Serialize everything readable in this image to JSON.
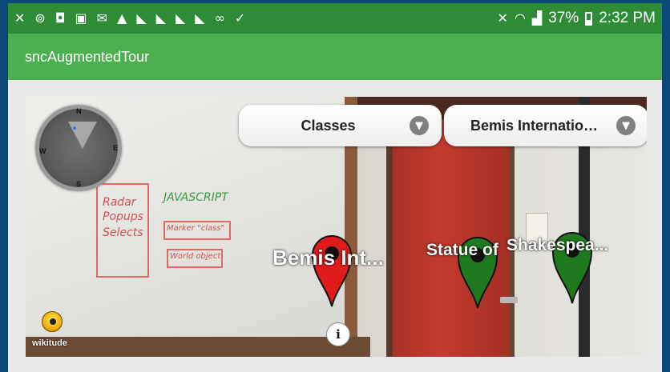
{
  "status_bar": {
    "icons": [
      "airplane-cross-icon",
      "sync-icon",
      "instagram-icon",
      "image-icon",
      "mail-icon",
      "warning-icon",
      "flipboard-icon",
      "flipboard-icon",
      "flipboard-icon",
      "flipboard-icon",
      "voicemail-icon",
      "clipboard-check-icon"
    ],
    "icon_glyphs": [
      "✕",
      "⊚",
      "◘",
      "▣",
      "✉",
      "▲",
      "◣",
      "◣",
      "◣",
      "◣",
      "∞",
      "✓"
    ],
    "battery_percent": "37%",
    "battery_level": 0.37,
    "time": "2:32 PM"
  },
  "app_bar": {
    "title": "sncAugmentedTour"
  },
  "ar_view": {
    "dropdowns": [
      {
        "label": "Classes"
      },
      {
        "label": "Bemis Internatio…"
      }
    ],
    "markers": [
      {
        "label": "Bemis Int...",
        "color": "#e01b1b"
      },
      {
        "label": "Statue of",
        "color": "#1f7a1f"
      },
      {
        "label": "Shakespea...",
        "color": "#1f7a1f"
      }
    ],
    "radar": {
      "north": "N",
      "east": "E",
      "south": "S",
      "west": "W"
    },
    "wikitude_text": "wikitude",
    "info_glyph": "i"
  },
  "whiteboard_text": {
    "radar": "Radar",
    "popups": "Popups",
    "selects": "Selects",
    "javascript": "JAVASCRIPT",
    "marker": "Marker \"class\"",
    "world": "World object"
  },
  "colors": {
    "status_bar": "#2e8b36",
    "app_bar": "#4caf50",
    "frame": "#0b4a78"
  }
}
